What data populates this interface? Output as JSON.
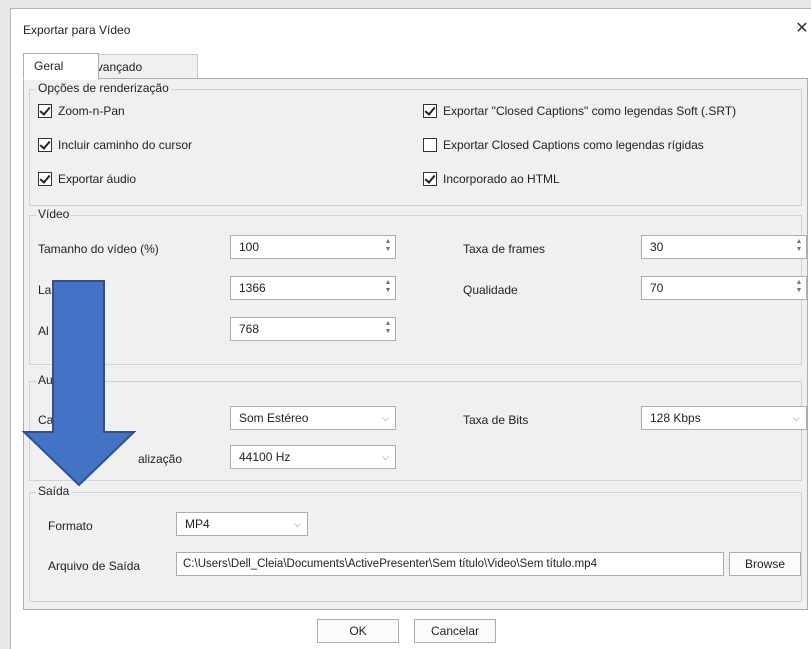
{
  "window": {
    "title": "Exportar para Vídeo",
    "close_glyph": "✕"
  },
  "tabs": [
    {
      "label": "Geral"
    },
    {
      "label": "Avançado"
    }
  ],
  "render": {
    "title": "Opções de renderização",
    "options": [
      {
        "label": "Zoom-n-Pan",
        "checked": true
      },
      {
        "label": "Incluir caminho do cursor",
        "checked": true
      },
      {
        "label": "Exportar áudio",
        "checked": true
      },
      {
        "label": "Exportar \"Closed Captions\" como legendas Soft (.SRT)",
        "checked": true
      },
      {
        "label": "Exportar Closed Captions como legendas rígidas",
        "checked": false
      },
      {
        "label": "Incorporado ao HTML",
        "checked": true
      }
    ]
  },
  "video": {
    "title": "Vídeo",
    "size_label": "Tamanho do vídeo (%)",
    "size_value": "100",
    "width_label": "La",
    "width_value": "1366",
    "height_label": "Al",
    "height_value": "768",
    "framerate_label": "Taxa de frames",
    "framerate_value": "30",
    "quality_label": "Qualidade",
    "quality_value": "70"
  },
  "audio": {
    "title": "Au",
    "channels_label": "Ca",
    "channels_value": "Som Estéreo",
    "bitrate_label": "Taxa de Bits",
    "bitrate_value": "128 Kbps",
    "samplerate_label": "alização",
    "samplerate_value": "44100 Hz"
  },
  "output": {
    "title": "Saída",
    "format_label": "Formato",
    "format_value": "MP4",
    "file_label": "Arquivo de Saída",
    "file_value": "C:\\Users\\Dell_Cleia\\Documents\\ActivePresenter\\Sem título\\Video\\Sem título.mp4",
    "browse_label": "Browse"
  },
  "buttons": {
    "ok": "OK",
    "cancel": "Cancelar"
  },
  "annotation": {
    "arrow_color": "#4472c4",
    "arrow_stroke": "#2f528f"
  }
}
